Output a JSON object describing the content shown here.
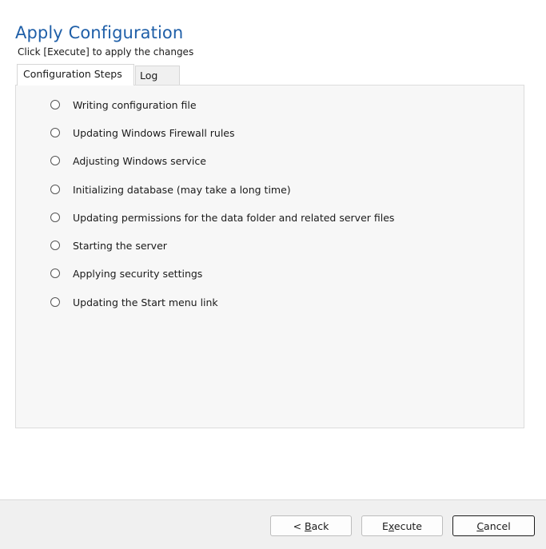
{
  "header": {
    "title": "Apply Configuration",
    "subtitle": "Click [Execute] to apply the changes"
  },
  "tabs": [
    {
      "label": "Configuration Steps",
      "active": true
    },
    {
      "label": "Log",
      "active": false
    }
  ],
  "steps": [
    {
      "label": "Writing configuration file",
      "icon": "radio-empty-icon"
    },
    {
      "label": "Updating Windows Firewall rules",
      "icon": "radio-empty-icon"
    },
    {
      "label": "Adjusting Windows service",
      "icon": "radio-empty-icon"
    },
    {
      "label": "Initializing database (may take a long time)",
      "icon": "radio-empty-icon"
    },
    {
      "label": "Updating permissions for the data folder and related server files",
      "icon": "radio-empty-icon"
    },
    {
      "label": "Starting the server",
      "icon": "radio-empty-icon"
    },
    {
      "label": "Applying security settings",
      "icon": "radio-empty-icon"
    },
    {
      "label": "Updating the Start menu link",
      "icon": "radio-empty-icon"
    }
  ],
  "footer": {
    "back": {
      "prefix": "< ",
      "accel": "B",
      "rest": "ack"
    },
    "execute": {
      "prefix": "E",
      "accel": "x",
      "rest": "ecute"
    },
    "cancel": {
      "prefix": "",
      "accel": "C",
      "rest": "ancel"
    }
  },
  "colors": {
    "title": "#1f5fa8",
    "panel_bg": "#f7f7f7",
    "footer_bg": "#f0f0f0"
  }
}
